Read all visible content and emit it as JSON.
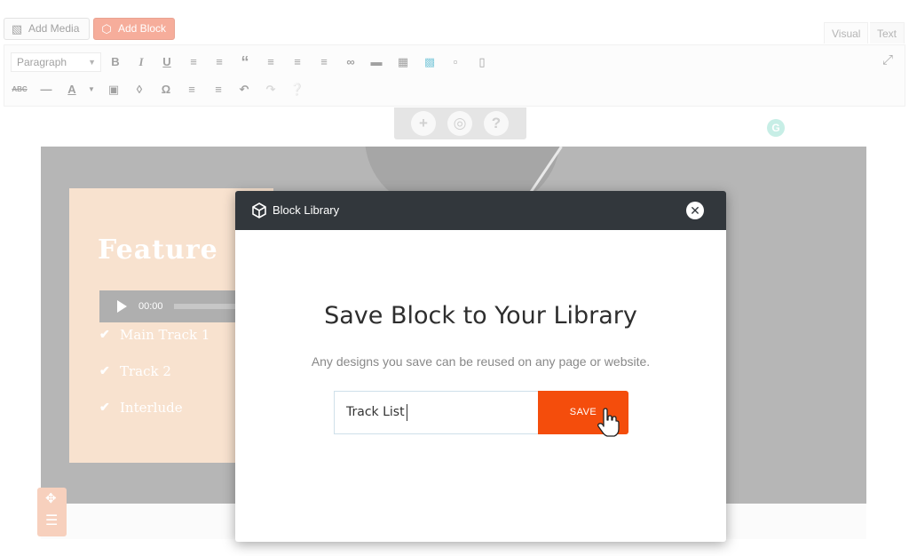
{
  "editor": {
    "add_media_label": "Add Media",
    "add_block_label": "Add Block",
    "tabs": {
      "visual": "Visual",
      "text": "Text"
    },
    "format_select": "Paragraph",
    "block_controls": [
      "+",
      "◎",
      "?"
    ]
  },
  "block_preview": {
    "title": "Feature",
    "audio_time": "00:00",
    "tracks": [
      "Main Track 1",
      "Track 2",
      "Interlude"
    ]
  },
  "modal": {
    "title": "Block Library",
    "heading": "Save Block to Your Library",
    "subtitle": "Any designs you save can be reused on any page or website.",
    "input_value": "Track List",
    "save_label": "SAVE"
  },
  "colors": {
    "accent": "#f44d0c",
    "add_block": "#ee6b4a",
    "header": "#32373c",
    "card": "#f3caa8"
  },
  "icons": [
    "media-icon",
    "cube-icon",
    "bold-icon",
    "italic-icon",
    "underline-icon",
    "bullet-list-icon",
    "numbered-list-icon",
    "quote-icon",
    "align-left-icon",
    "align-center-icon",
    "align-right-icon",
    "link-icon",
    "read-more-icon",
    "table-icon",
    "desktop-icon",
    "tablet-icon",
    "mobile-icon",
    "fullscreen-icon",
    "strikethrough-icon",
    "horizontal-rule-icon",
    "text-color-icon",
    "paste-text-icon",
    "clear-format-icon",
    "omega-icon",
    "outdent-icon",
    "indent-icon",
    "undo-icon",
    "redo-icon",
    "help-icon",
    "play-icon",
    "check-icon",
    "close-icon",
    "move-icon",
    "menu-icon",
    "hand-cursor-icon"
  ]
}
